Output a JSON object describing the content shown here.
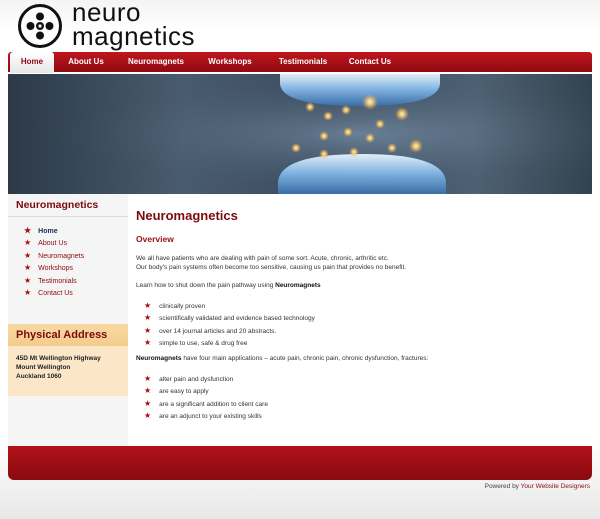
{
  "logo": {
    "line1": "neuro",
    "line2": "magnetics",
    "mark_icon": "neuromagnetics-logo-icon"
  },
  "nav": [
    {
      "label": "Home",
      "active": true
    },
    {
      "label": "About Us"
    },
    {
      "label": "Neuromagnets"
    },
    {
      "label": "Workshops"
    },
    {
      "label": "Testimonials"
    },
    {
      "label": "Contact Us"
    }
  ],
  "banner": {
    "icon": "synapse-banner-image"
  },
  "sidebar": {
    "title": "Neuromagnetics",
    "items": [
      "Home",
      "About Us",
      "Neuromagnets",
      "Workshops",
      "Testimonials",
      "Contact Us"
    ],
    "address": {
      "heading": "Physical Address",
      "lines": [
        "45D Mt Wellington Highway",
        "Mount Wellington",
        "Auckland 1060"
      ]
    }
  },
  "content": {
    "title": "Neuromagnetics",
    "subtitle": "Overview",
    "para1_line1": "We all have patients who are dealing with pain of some sort. Acute, chronic, arthritic etc.",
    "para1_line2": "Our body's pain systems often become too sensitive, causing us pain that provides no benefit.",
    "para2_prefix": "Learn how to shut down the pain pathway using ",
    "para2_bold": "Neuromagnets",
    "list1": [
      "clinically proven",
      "scientifically validated and evidence based technology",
      "over 14 journal articles and 20 abstracts.",
      "simple to use, safe & drug free"
    ],
    "para3_bold": "Neuromagnets",
    "para3_rest": " have four main applications – acute pain, chronic pain, chronic dysfunction, fractures:",
    "list2": [
      "alter pain and dysfunction",
      "are easy to apply",
      "are a significant addition to client care",
      "are an adjunct to your existing skills"
    ]
  },
  "footer": {
    "powered_prefix": "Powered by ",
    "powered_link": "Your Website Designers"
  },
  "colors": {
    "brand_red": "#a80d14",
    "dark_red": "#7c0a0e",
    "address_bg": "#fbe7c8"
  }
}
